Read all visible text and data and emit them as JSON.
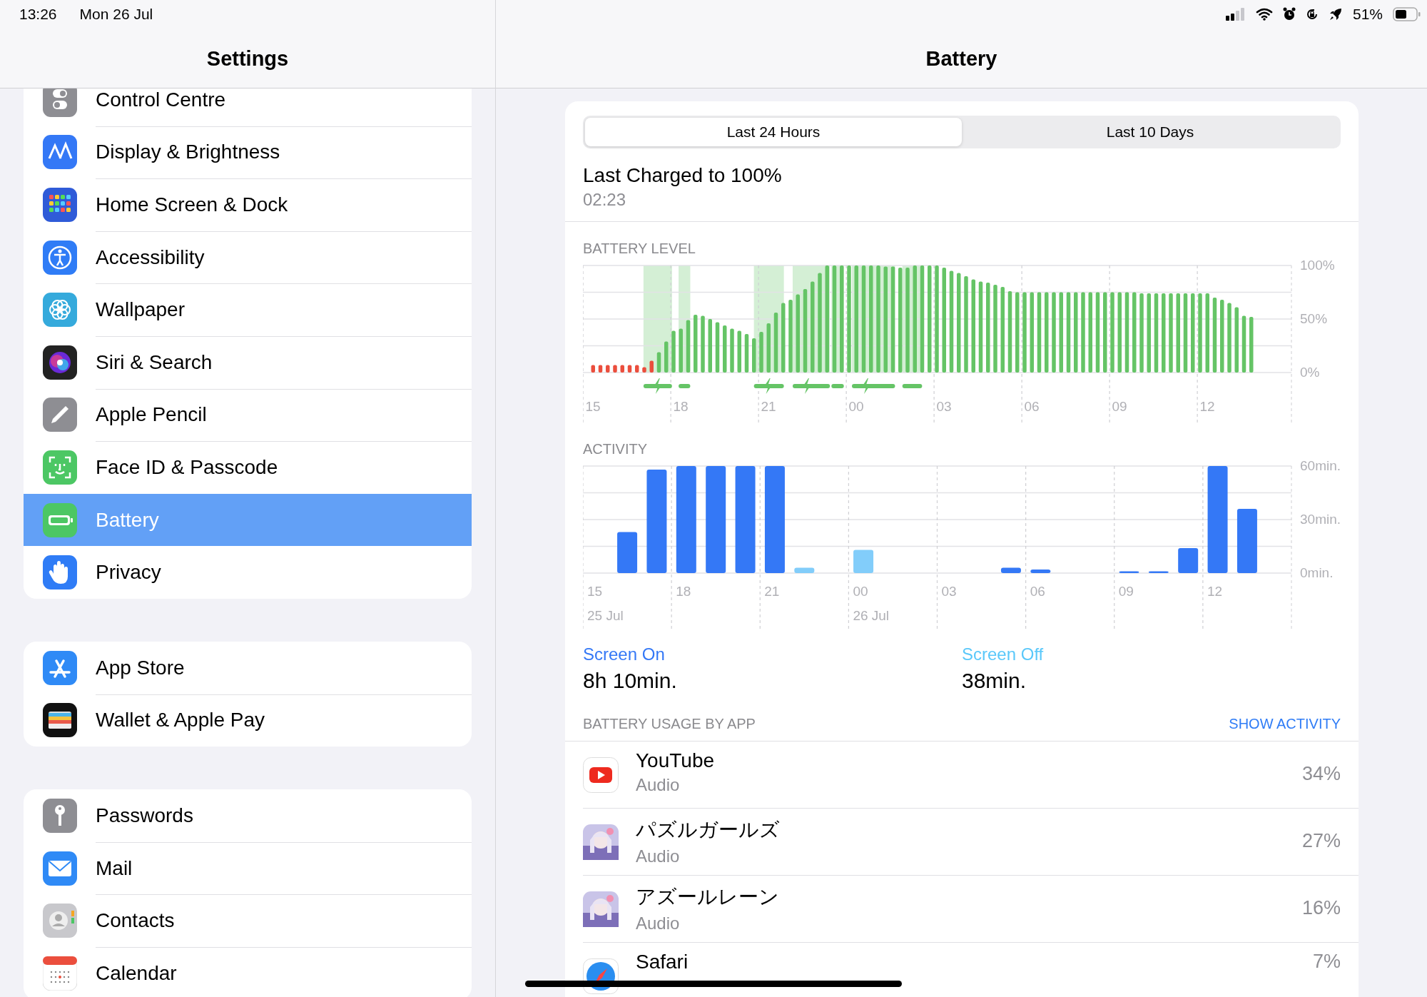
{
  "status_bar": {
    "time": "13:26",
    "date": "Mon 26 Jul",
    "battery": "51%"
  },
  "sidebar": {
    "title": "Settings",
    "groups": [
      [
        {
          "label": "Control Centre",
          "kind": "controls",
          "selected": false
        },
        {
          "label": "Display & Brightness",
          "kind": "display",
          "selected": false
        },
        {
          "label": "Home Screen & Dock",
          "kind": "homescreen",
          "selected": false
        },
        {
          "label": "Accessibility",
          "kind": "accessibility",
          "selected": false
        },
        {
          "label": "Wallpaper",
          "kind": "wallpaper",
          "selected": false
        },
        {
          "label": "Siri & Search",
          "kind": "siri",
          "selected": false
        },
        {
          "label": "Apple Pencil",
          "kind": "pencil",
          "selected": false
        },
        {
          "label": "Face ID & Passcode",
          "kind": "faceid",
          "selected": false
        },
        {
          "label": "Battery",
          "kind": "battery",
          "selected": true
        },
        {
          "label": "Privacy",
          "kind": "privacy",
          "selected": false
        }
      ],
      [
        {
          "label": "App Store",
          "kind": "appstore",
          "selected": false
        },
        {
          "label": "Wallet & Apple Pay",
          "kind": "wallet",
          "selected": false
        }
      ],
      [
        {
          "label": "Passwords",
          "kind": "passwords",
          "selected": false
        },
        {
          "label": "Mail",
          "kind": "mail",
          "selected": false
        },
        {
          "label": "Contacts",
          "kind": "contacts",
          "selected": false
        },
        {
          "label": "Calendar",
          "kind": "calendar",
          "selected": false
        }
      ]
    ]
  },
  "detail": {
    "title": "Battery",
    "tabs": [
      {
        "label": "Last 24 Hours",
        "selected": true
      },
      {
        "label": "Last 10 Days",
        "selected": false
      }
    ],
    "last_charged": {
      "title": "Last Charged to 100%",
      "time": "02:23"
    },
    "battery_level": {
      "label": "BATTERY LEVEL",
      "chart_data": {
        "type": "bar",
        "ylim": [
          0,
          100
        ],
        "categories": [
          "15",
          null,
          null,
          null,
          null,
          null,
          null,
          null,
          null,
          null,
          null,
          null,
          "18",
          null,
          null,
          null,
          null,
          null,
          null,
          null,
          null,
          null,
          null,
          null,
          "21",
          null,
          null,
          null,
          null,
          null,
          null,
          null,
          null,
          null,
          null,
          null,
          "00",
          null,
          null,
          null,
          null,
          null,
          null,
          null,
          null,
          null,
          null,
          null,
          "03",
          null,
          null,
          null,
          null,
          null,
          null,
          null,
          null,
          null,
          null,
          null,
          "06",
          null,
          null,
          null,
          null,
          null,
          null,
          null,
          null,
          null,
          null,
          null,
          "09",
          null,
          null,
          null,
          null,
          null,
          null,
          null,
          null,
          null,
          null,
          null,
          "12",
          null,
          null,
          null,
          null,
          null,
          null,
          null,
          null,
          null,
          null,
          null
        ],
        "yticks": [
          {
            "value": 0,
            "label": "0%"
          },
          {
            "value": 50,
            "label": "50%"
          },
          {
            "value": 100,
            "label": "100%"
          }
        ],
        "series": [
          {
            "color": "#eb4e3d",
            "values": [
              7,
              7,
              7,
              7,
              7,
              7,
              7,
              5,
              11,
              null,
              null,
              null,
              null,
              null,
              null,
              null,
              null,
              null,
              null,
              null,
              null,
              null,
              null,
              null,
              null,
              null,
              null,
              null,
              null,
              null,
              null,
              null,
              null,
              null,
              null,
              null,
              null,
              null,
              null,
              null,
              null,
              null,
              null,
              null,
              null,
              null,
              null,
              null,
              null,
              null,
              null,
              null,
              null,
              null,
              null,
              null,
              null,
              null,
              null,
              null,
              null,
              null,
              null,
              null,
              null,
              null,
              null,
              null,
              null,
              null,
              null,
              null,
              null,
              null,
              null,
              null,
              null,
              null,
              null,
              null,
              null,
              null,
              null,
              null,
              null,
              null,
              null,
              null,
              null,
              null,
              null,
              null,
              null,
              null,
              null,
              null
            ]
          },
          {
            "color": "#65c466",
            "values": [
              null,
              null,
              null,
              null,
              null,
              null,
              null,
              null,
              null,
              19,
              29,
              39,
              41,
              49,
              54,
              53,
              50,
              47,
              44,
              41,
              39,
              36,
              32,
              38,
              46,
              56,
              65,
              68,
              73,
              78,
              85,
              93,
              100,
              100,
              100,
              100,
              100,
              100,
              100,
              100,
              99,
              99,
              98,
              98,
              100,
              100,
              100,
              100,
              98,
              95,
              93,
              90,
              87,
              85,
              84,
              82,
              80,
              76,
              75,
              75,
              75,
              75,
              75,
              75,
              75,
              75,
              75,
              75,
              75,
              75,
              75,
              75,
              75,
              75,
              75,
              74,
              74,
              74,
              74,
              74,
              74,
              74,
              74,
              74,
              74,
              70,
              68,
              65,
              61,
              53,
              52,
              null,
              null,
              null,
              null,
              null
            ]
          }
        ]
      }
    },
    "activity": {
      "label": "ACTIVITY",
      "dates": [
        "25 Jul",
        "26 Jul"
      ],
      "chart_data": {
        "type": "bar",
        "ylim": [
          0,
          60
        ],
        "categories": [
          "15",
          null,
          null,
          "18",
          null,
          null,
          "21",
          null,
          null,
          "00",
          null,
          null,
          "03",
          null,
          null,
          "06",
          null,
          null,
          "09",
          null,
          null,
          "12",
          null,
          null
        ],
        "yticks": [
          {
            "value": 0,
            "label": "0min."
          },
          {
            "value": 30,
            "label": "30min."
          },
          {
            "value": 60,
            "label": "60min."
          }
        ],
        "series": [
          {
            "color": "#3478f6",
            "values": [
              0,
              23,
              58,
              60,
              60,
              60,
              60,
              0,
              0,
              0,
              0,
              0,
              0,
              0,
              3,
              2,
              0,
              0,
              1,
              1,
              14,
              60,
              36,
              null
            ]
          },
          {
            "color": "#82cdfa",
            "values": [
              0,
              0,
              0,
              0,
              0,
              0,
              0,
              3,
              0,
              13,
              0,
              0,
              0,
              0,
              0,
              0,
              0,
              0,
              0,
              0,
              0,
              0,
              0,
              null
            ]
          }
        ]
      }
    },
    "screen_time": [
      {
        "label": "Screen On",
        "value": "8h 10min.",
        "color": "#3478f6"
      },
      {
        "label": "Screen Off",
        "value": "38min.",
        "color": "#5ac8fa"
      }
    ],
    "usage": {
      "label": "BATTERY USAGE BY APP",
      "action": "SHOW ACTIVITY",
      "apps": [
        {
          "name": "YouTube",
          "detail": "Audio",
          "percent": "34%",
          "kind": "youtube"
        },
        {
          "name": "パズルガールズ",
          "detail": "Audio",
          "percent": "27%",
          "kind": "picture"
        },
        {
          "name": "アズールレーン",
          "detail": "Audio",
          "percent": "16%",
          "kind": "picture"
        },
        {
          "name": "Safari",
          "percent": "7%",
          "kind": "safari"
        }
      ]
    }
  }
}
